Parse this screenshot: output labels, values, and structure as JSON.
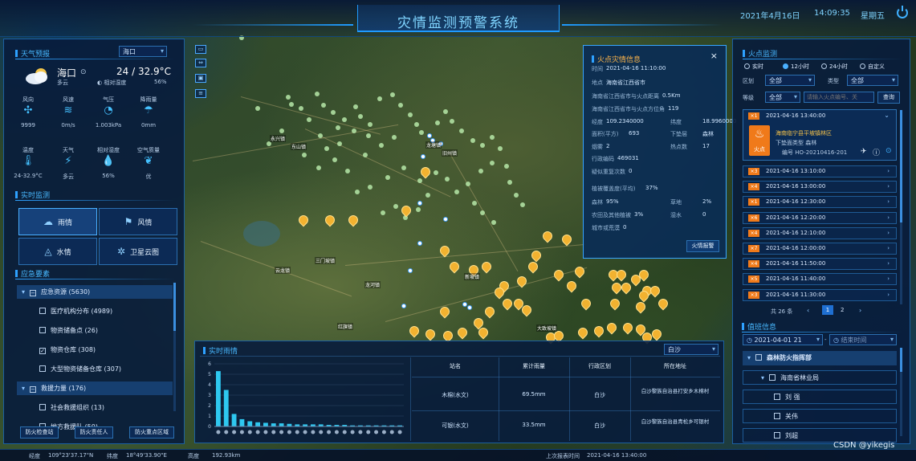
{
  "header": {
    "title": "灾情监测预警系统",
    "date": "2021年4月16日",
    "time": "14:09:35",
    "weekday": "星期五"
  },
  "weather": {
    "section_title": "天气预报",
    "city_select": "海口",
    "city": "海口",
    "condition": "多云",
    "temp": "24 / 32.9°C",
    "humidity_label": "相对湿度",
    "humidity_value": "56%",
    "row1": [
      {
        "label": "风向",
        "value": "9999",
        "icon": "wind-direction-icon"
      },
      {
        "label": "风速",
        "value": "0m/s",
        "icon": "wind-speed-icon"
      },
      {
        "label": "气压",
        "value": "1.003kPa",
        "icon": "pressure-icon"
      },
      {
        "label": "降雨量",
        "value": "0mm",
        "icon": "rainfall-icon"
      }
    ],
    "row2": [
      {
        "label": "温度",
        "value": "24-32.9°C",
        "icon": "thermometer-icon"
      },
      {
        "label": "天气",
        "value": "多云",
        "icon": "lightning-icon"
      },
      {
        "label": "相对湿度",
        "value": "56%",
        "icon": "drop-icon"
      },
      {
        "label": "空气质量",
        "value": "优",
        "icon": "leaf-icon"
      }
    ]
  },
  "realtime": {
    "section_title": "实时监测",
    "tiles": [
      {
        "label": "雨情",
        "icon": "cloud-rain-icon"
      },
      {
        "label": "风情",
        "icon": "wind-flag-icon"
      },
      {
        "label": "水情",
        "icon": "water-icon"
      },
      {
        "label": "卫星云图",
        "icon": "satellite-icon"
      }
    ]
  },
  "resources": {
    "section_title": "应急要素",
    "tree": [
      {
        "label": "应急资源 (5630)",
        "level": 0,
        "state": "−"
      },
      {
        "label": "医疗机构分布 (4989)",
        "level": 1,
        "state": ""
      },
      {
        "label": "物资储备点 (26)",
        "level": 1,
        "state": ""
      },
      {
        "label": "物资仓库 (308)",
        "level": 1,
        "state": "✓"
      },
      {
        "label": "大型物资储备仓库 (307)",
        "level": 1,
        "state": ""
      },
      {
        "label": "救援力量 (176)",
        "level": 0,
        "state": "−"
      },
      {
        "label": "社会救援组织 (13)",
        "level": 1,
        "state": ""
      },
      {
        "label": "地方救援队 (50)",
        "level": 1,
        "state": ""
      }
    ],
    "buttons": [
      "防火检查站",
      "防火责任人",
      "防火重点区域"
    ]
  },
  "map": {
    "towns": [
      "永兴镇",
      "东山镇",
      "龙塘镇",
      "旧州镇",
      "三门坡镇",
      "龙河镇",
      "新坡镇",
      "云龙镇",
      "红旗镇",
      "大致坡镇"
    ]
  },
  "popup": {
    "title": "火点灾情信息",
    "time_label": "时间",
    "time_value": "2021-04-16 11:10:00",
    "place_label": "地点",
    "place_value": "海南省江西省市",
    "dist_label": "海南省江西省市与火点距离",
    "dist_value": "0.5Km",
    "dir_label": "海南省江西省市与火点方位角",
    "dir_value": "119",
    "lng_label": "经度",
    "lng_value": "109.2340000",
    "lat_label": "纬度",
    "lat_value": "18.9960000",
    "area_label": "面积(平方)",
    "area_value": "693",
    "ir_label": "下垫层",
    "ir_value": "森林",
    "smoke_label": "烟雾",
    "smoke_value": "2",
    "hot_label": "热点数",
    "hot_value": "17",
    "adcode_label": "行政编码",
    "adcode_value": "469031",
    "repeat_label": "疑似重复次数",
    "repeat_value": "0",
    "veg_label": "植被覆盖度(平均)",
    "veg_value": "37%",
    "forest_label": "森林",
    "forest_value": "95%",
    "grass_label": "草地",
    "grass_value": "2%",
    "farm_label": "农田及其他植被",
    "farm_value": "3%",
    "water_label": "湿水",
    "water_value": "0",
    "urban_label": "城市或荒漠",
    "urban_value": "0",
    "button": "火情报警"
  },
  "firelist": {
    "section_title": "火点监测",
    "radios": [
      "实时",
      "12小时",
      "24小时",
      "自定义"
    ],
    "region_label": "区划",
    "region_value": "全部",
    "type_label": "类型",
    "type_value": "全部",
    "level_label": "等级",
    "level_value": "全部",
    "search_placeholder": "请输入火点编号、关",
    "search_button": "查询",
    "expanded": {
      "badge": "×1",
      "time": "2021-04-16 13:40:00",
      "place": "海南临宁县平坡镇林区",
      "ground": "下垫面类型 森林",
      "id": "编号 HO-20210416-201",
      "fire_tag": "火点"
    },
    "items": [
      {
        "badge": "×3",
        "time": "2021-04-16 13:10:00"
      },
      {
        "badge": "×4",
        "time": "2021-04-16 13:00:00"
      },
      {
        "badge": "×1",
        "time": "2021-04-16 12:30:00"
      },
      {
        "badge": "×6",
        "time": "2021-04-16 12:20:00"
      },
      {
        "badge": "×4",
        "time": "2021-04-16 12:10:00"
      },
      {
        "badge": "×7",
        "time": "2021-04-16 12:00:00"
      },
      {
        "badge": "×4",
        "time": "2021-04-16 11:50:00"
      },
      {
        "badge": "×5",
        "time": "2021-04-16 11:40:00"
      },
      {
        "badge": "×3",
        "time": "2021-04-16 11:30:00"
      }
    ],
    "pager_total": "共 26 条",
    "pages": [
      "1",
      "2"
    ]
  },
  "duty": {
    "section_title": "值班信息",
    "date": "2021-04-01 21",
    "end_placeholder": "结束时间",
    "tree": [
      {
        "label": "森林防火指挥部",
        "level": 0
      },
      {
        "label": "海南省林业局",
        "level": 1
      },
      {
        "label": "刘 强",
        "level": 2
      },
      {
        "label": "关伟",
        "level": 2
      },
      {
        "label": "刘超",
        "level": 2
      }
    ]
  },
  "rain": {
    "section_title": "实时雨情",
    "select": "白沙",
    "table_headers": [
      "站名",
      "累计雨量",
      "行政区划",
      "所在地址"
    ],
    "rows": [
      {
        "name": "木棉(水文)",
        "rain": "69.5mm",
        "district": "白沙",
        "address": "白沙黎族自治县打安乡木棉村"
      },
      {
        "name": "可银(水文)",
        "rain": "33.5mm",
        "district": "白沙",
        "address": "白沙黎族自治县青松乡可银村"
      }
    ]
  },
  "chart_data": {
    "type": "bar",
    "ylim": [
      0,
      6
    ],
    "yticks": [
      "0",
      "1",
      "2",
      "3",
      "4",
      "5",
      "6"
    ],
    "values": [
      5.3,
      3.5,
      1.2,
      0.7,
      0.5,
      0.4,
      0.35,
      0.3,
      0.3,
      0.25,
      0.2,
      0.2,
      0.2,
      0.2,
      0.15,
      0.15,
      0.15,
      0.1,
      0.1,
      0.1,
      0.1,
      0.1,
      0.1,
      0.1
    ],
    "color": "#2ec8f0"
  },
  "bottombar": {
    "lng_label": "经度",
    "lng_value": "109°23'37.17\"N",
    "lat_label": "纬度",
    "lat_value": "18°49'33.90\"E",
    "alt_label": "高度",
    "alt_value": "192.93km",
    "report_label": "上次报表时间",
    "report_value": "2021-04-16 13:40:00",
    "watermark": "CSDN @yikegis"
  }
}
